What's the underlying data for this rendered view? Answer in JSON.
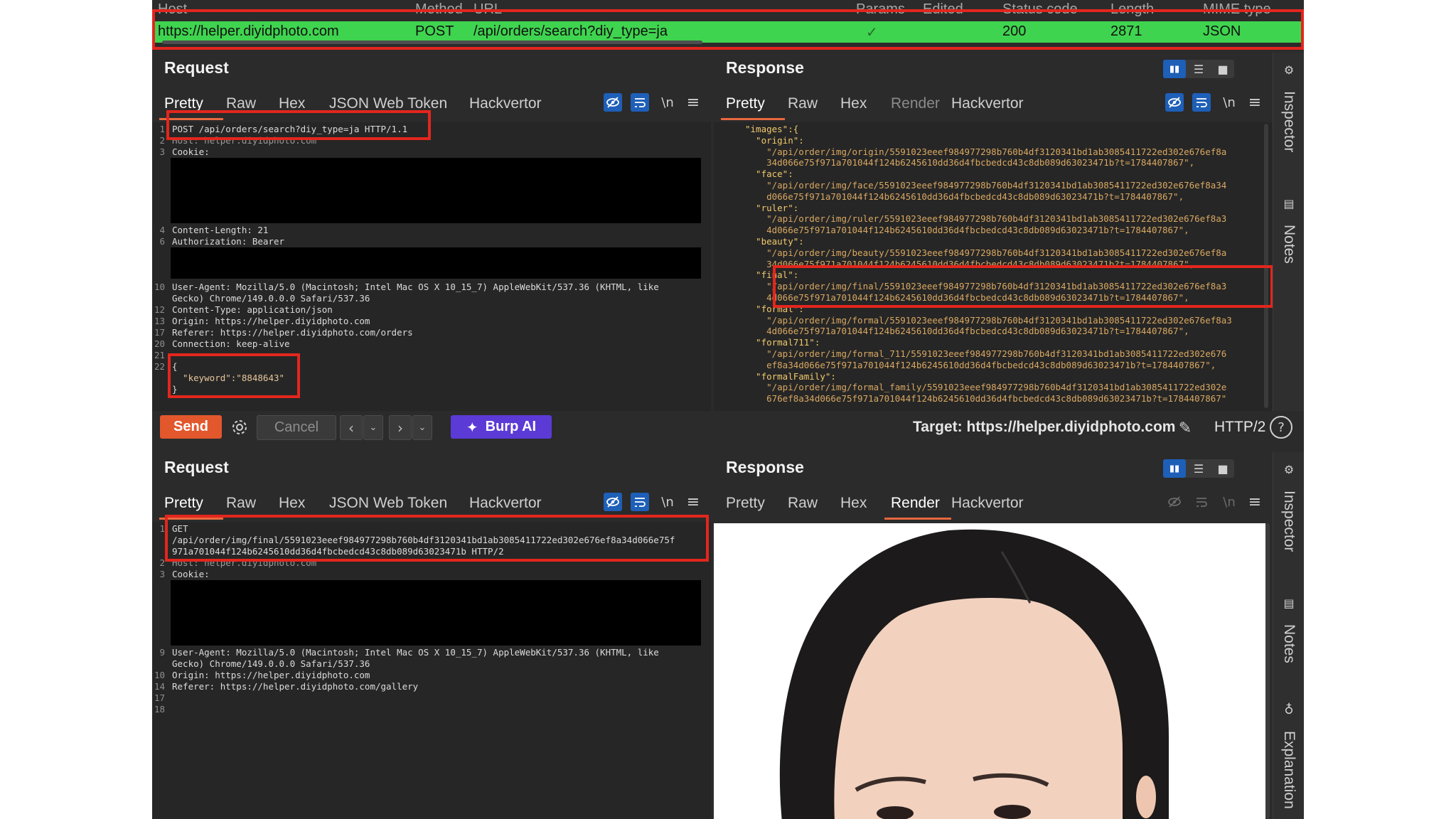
{
  "history": {
    "columns": [
      "Host",
      "Method",
      "URL",
      "Params",
      "Edited",
      "Status code",
      "Length",
      "MIME type"
    ],
    "row": {
      "host": "https://helper.diyidphoto.com",
      "method": "POST",
      "url": "/api/orders/search?diy_type=ja",
      "params": "✓",
      "status": "200",
      "length": "2871",
      "mime": "JSON"
    },
    "row_color": "#3fd44f"
  },
  "top_request": {
    "title": "Request",
    "tabs": [
      "Pretty",
      "Raw",
      "Hex",
      "JSON Web Token",
      "Hackvertor"
    ],
    "active_tab": "Pretty",
    "line_numbers": [
      "1",
      "2",
      "3",
      "4",
      "6",
      "10",
      "12",
      "13",
      "17",
      "20",
      "21",
      "22"
    ],
    "request_line": "POST /api/orders/search?diy_type=ja HTTP/1.1",
    "host_line": "Host: helper.diyidphoto.com",
    "cookie_line": "Cookie:",
    "content_length": "Content-Length: 21",
    "authorization": "Authorization: Bearer",
    "user_agent_1": "User-Agent: Mozilla/5.0 (Macintosh; Intel Mac OS X 10_15_7) AppleWebKit/537.36 (KHTML, like",
    "user_agent_2": "Gecko) Chrome/149.0.0.0 Safari/537.36",
    "content_type": "Content-Type: application/json",
    "origin": "Origin: https://helper.diyidphoto.com",
    "referer": "Referer: https://helper.diyidphoto.com/orders",
    "connection": "Connection: keep-alive",
    "body_open": "{",
    "body_kv": "  \"keyword\":\"8848643\"",
    "body_close": "}"
  },
  "top_response": {
    "title": "Response",
    "tabs": [
      "Pretty",
      "Raw",
      "Hex",
      "Render",
      "Hackvertor"
    ],
    "active_tab": "Pretty",
    "lines": [
      "\"images\":{",
      "  \"origin\":",
      "    \"/api/order/img/origin/5591023eeef984977298b760b4df3120341bd1ab3085411722ed302e676ef8a",
      "    34d066e75f971a701044f124b6245610dd36d4fbcbedcd43c8db089d63023471b?t=1784407867\",",
      "  \"face\":",
      "    \"/api/order/img/face/5591023eeef984977298b760b4df3120341bd1ab3085411722ed302e676ef8a34",
      "    d066e75f971a701044f124b6245610dd36d4fbcbedcd43c8db089d63023471b?t=1784407867\",",
      "  \"ruler\":",
      "    \"/api/order/img/ruler/5591023eeef984977298b760b4df3120341bd1ab3085411722ed302e676ef8a3",
      "    4d066e75f971a701044f124b6245610dd36d4fbcbedcd43c8db089d63023471b?t=1784407867\",",
      "  \"beauty\":",
      "    \"/api/order/img/beauty/5591023eeef984977298b760b4df3120341bd1ab3085411722ed302e676ef8a",
      "    34d066e75f971a701044f124b6245610dd36d4fbcbedcd43c8db089d63023471b?t=1784407867\",",
      "  \"final\":",
      "    \"/api/order/img/final/5591023eeef984977298b760b4df3120341bd1ab3085411722ed302e676ef8a3",
      "    4d066e75f971a701044f124b6245610dd36d4fbcbedcd43c8db089d63023471b?t=1784407867\",",
      "  \"formal\":",
      "    \"/api/order/img/formal/5591023eeef984977298b760b4df3120341bd1ab3085411722ed302e676ef8a3",
      "    4d066e75f971a701044f124b6245610dd36d4fbcbedcd43c8db089d63023471b?t=1784407867\",",
      "  \"formal711\":",
      "    \"/api/order/img/formal_711/5591023eeef984977298b760b4df3120341bd1ab3085411722ed302e676",
      "    ef8a34d066e75f971a701044f124b6245610dd36d4fbcbedcd43c8db089d63023471b?t=1784407867\",",
      "  \"formalFamily\":",
      "    \"/api/order/img/formal_family/5591023eeef984977298b760b4df3120341bd1ab3085411722ed302e",
      "    676ef8a34d066e75f971a701044f124b6245610dd36d4fbcbedcd43c8db089d63023471b?t=1784407867\""
    ]
  },
  "toolbar": {
    "send_label": "Send",
    "cancel_label": "Cancel",
    "burp_ai_label": "Burp AI",
    "target_label": "Target: https://helper.diyidphoto.com",
    "protocol_label": "HTTP/2"
  },
  "bottom_request": {
    "title": "Request",
    "tabs": [
      "Pretty",
      "Raw",
      "Hex",
      "JSON Web Token",
      "Hackvertor"
    ],
    "active_tab": "Pretty",
    "line_numbers": [
      "1",
      "2",
      "3",
      "9",
      "10",
      "14",
      "17",
      "18"
    ],
    "req_1": "GET",
    "req_2": "/api/order/img/final/5591023eeef984977298b760b4df3120341bd1ab3085411722ed302e676ef8a34d066e75f",
    "req_3": "971a701044f124b6245610dd36d4fbcbedcd43c8db089d63023471b HTTP/2",
    "host_line": "Host: helper.diyidphoto.com",
    "cookie_line": "Cookie:",
    "user_agent_1": "User-Agent: Mozilla/5.0 (Macintosh; Intel Mac OS X 10_15_7) AppleWebKit/537.36 (KHTML, like",
    "user_agent_2": "Gecko) Chrome/149.0.0.0 Safari/537.36",
    "origin": "Origin: https://helper.diyidphoto.com",
    "referer": "Referer: https://helper.diyidphoto.com/gallery"
  },
  "bottom_response": {
    "title": "Response",
    "tabs": [
      "Pretty",
      "Raw",
      "Hex",
      "Render",
      "Hackvertor"
    ],
    "active_tab": "Render"
  },
  "side_panels": {
    "top": [
      "Inspector",
      "Notes"
    ],
    "bottom": [
      "Inspector",
      "Notes",
      "Explanation"
    ]
  },
  "icons": {
    "hide": "eye-slash-icon",
    "wrap": "wrap-icon",
    "newline": "\\n",
    "menu": "≡",
    "settings": "gear-icon",
    "sparkle": "sparkle-icon",
    "edit": "pencil-icon",
    "help": "?"
  },
  "colors": {
    "highlight_red": "#e3261d",
    "send": "#e2572c",
    "burp_ai": "#5b3ad6",
    "tab_accent": "#e8683f"
  }
}
